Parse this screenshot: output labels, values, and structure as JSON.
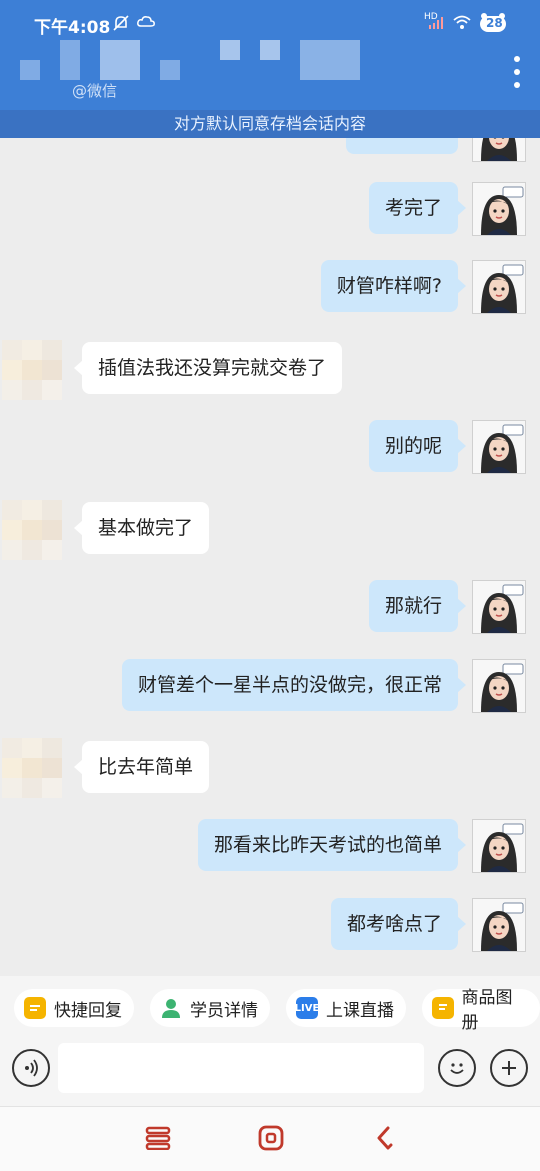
{
  "status_bar": {
    "time": "下午4:08",
    "network": "HD",
    "battery": "28"
  },
  "header": {
    "subname": "@微信",
    "notice": "对方默认同意存档会话内容"
  },
  "messages": [
    {
      "side": "me",
      "text": "考完了"
    },
    {
      "side": "me",
      "text": "财管咋样啊?"
    },
    {
      "side": "peer",
      "text": "插值法我还没算完就交卷了"
    },
    {
      "side": "me",
      "text": "别的呢"
    },
    {
      "side": "peer",
      "text": "基本做完了"
    },
    {
      "side": "me",
      "text": "那就行"
    },
    {
      "side": "me",
      "text": "财管差个一星半点的没做完，很正常"
    },
    {
      "side": "peer",
      "text": "比去年简单"
    },
    {
      "side": "me",
      "text": "那看来比昨天考试的也简单"
    },
    {
      "side": "me",
      "text": "都考啥点了"
    }
  ],
  "quick_tools": [
    {
      "label": "快捷回复",
      "icon": "quick-reply-icon",
      "color": "#f5b400"
    },
    {
      "label": "学员详情",
      "icon": "student-icon",
      "color": "#3cb371"
    },
    {
      "label": "上课直播",
      "icon": "live-icon",
      "color": "#2b7de9"
    },
    {
      "label": "商品图册",
      "icon": "catalog-icon",
      "color": "#f5b400"
    }
  ],
  "input": {
    "placeholder": ""
  },
  "colors": {
    "header": "#3d7fd6",
    "me_bubble": "#cde7fb",
    "nav_accent": "#c0392b"
  }
}
